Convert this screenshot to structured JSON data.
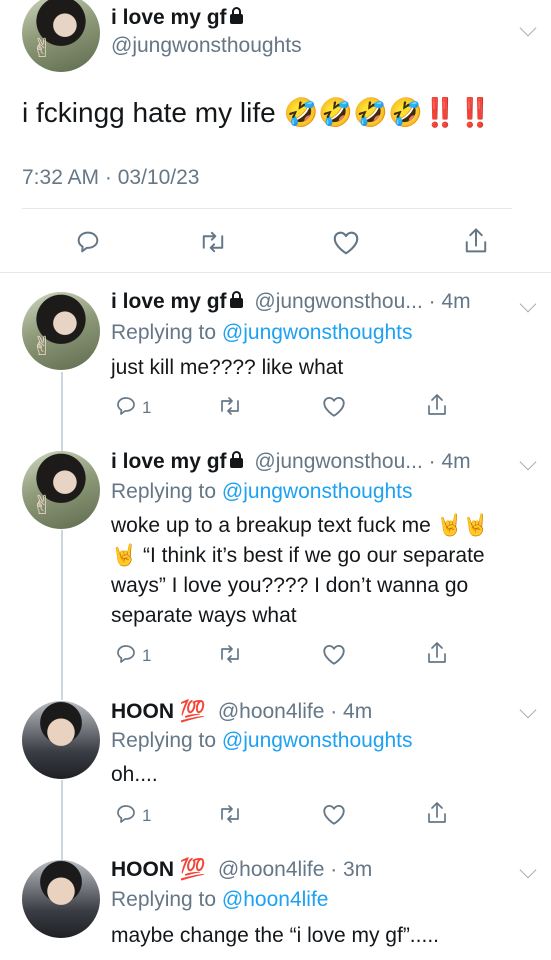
{
  "main_tweet": {
    "display_name": "i love my gf",
    "handle": "@jungwonsthoughts",
    "text": "i fckingg hate my life 🤣🤣🤣🤣‼️‼️",
    "timestamp": "7:32 AM · 03/10/23"
  },
  "replies": [
    {
      "display_name": "i love my gf",
      "handle_time": "@jungwonsthou... · 4m",
      "replying_label": "Replying to",
      "replying_to": "@jungwonsthoughts",
      "text_lines": [
        "just kill me???? like what"
      ],
      "reply_count": "1"
    },
    {
      "display_name": "i love my gf",
      "handle_time": "@jungwonsthou... · 4m",
      "replying_label": "Replying to",
      "replying_to": "@jungwonsthoughts",
      "text_lines": [
        "woke up to a breakup text fuck me 🤘🤘",
        "🤘 “I think it’s best if we go our separate",
        "ways” I love you???? I don’t wanna go",
        "separate ways what"
      ],
      "reply_count": "1"
    },
    {
      "display_name": "HOON 💯",
      "handle_time": "@hoon4life · 4m",
      "replying_label": "Replying to",
      "replying_to": "@jungwonsthoughts",
      "text_lines": [
        "oh...."
      ],
      "reply_count": "1"
    },
    {
      "display_name": "HOON 💯",
      "handle_time": "@hoon4life · 3m",
      "replying_label": "Replying to",
      "replying_to": "@hoon4life",
      "text_lines": [
        "maybe change the “i love my gf”....."
      ]
    }
  ],
  "colors": {
    "link": "#1da1f2",
    "secondary": "#657786",
    "divider": "#e1e8ed"
  },
  "icons": [
    "reply-icon",
    "retweet-icon",
    "like-icon",
    "share-icon",
    "chevron-down-icon",
    "lock-icon"
  ]
}
